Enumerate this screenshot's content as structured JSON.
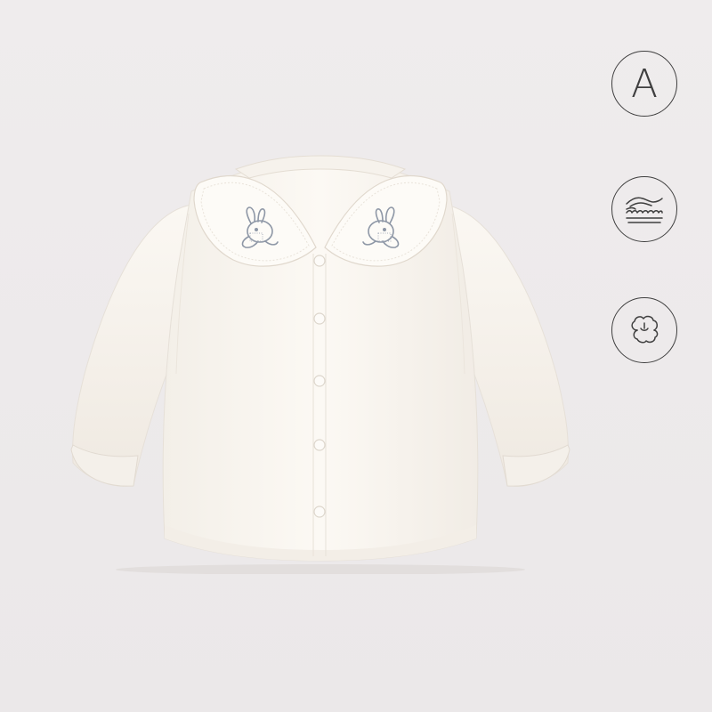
{
  "badges": [
    {
      "icon": "letter-a-icon",
      "letter": "A"
    },
    {
      "icon": "soft-cushion-icon"
    },
    {
      "icon": "cotton-flower-icon"
    }
  ],
  "product": {
    "item": "baby-shirt",
    "color": "#fbf8f3",
    "collar": "peter-pan",
    "embroidery": "bunny",
    "embroidery_color": "#8e97a6",
    "button_count": 5
  },
  "colors": {
    "background": "#eeebec",
    "icon_stroke": "#3f3f3f"
  }
}
